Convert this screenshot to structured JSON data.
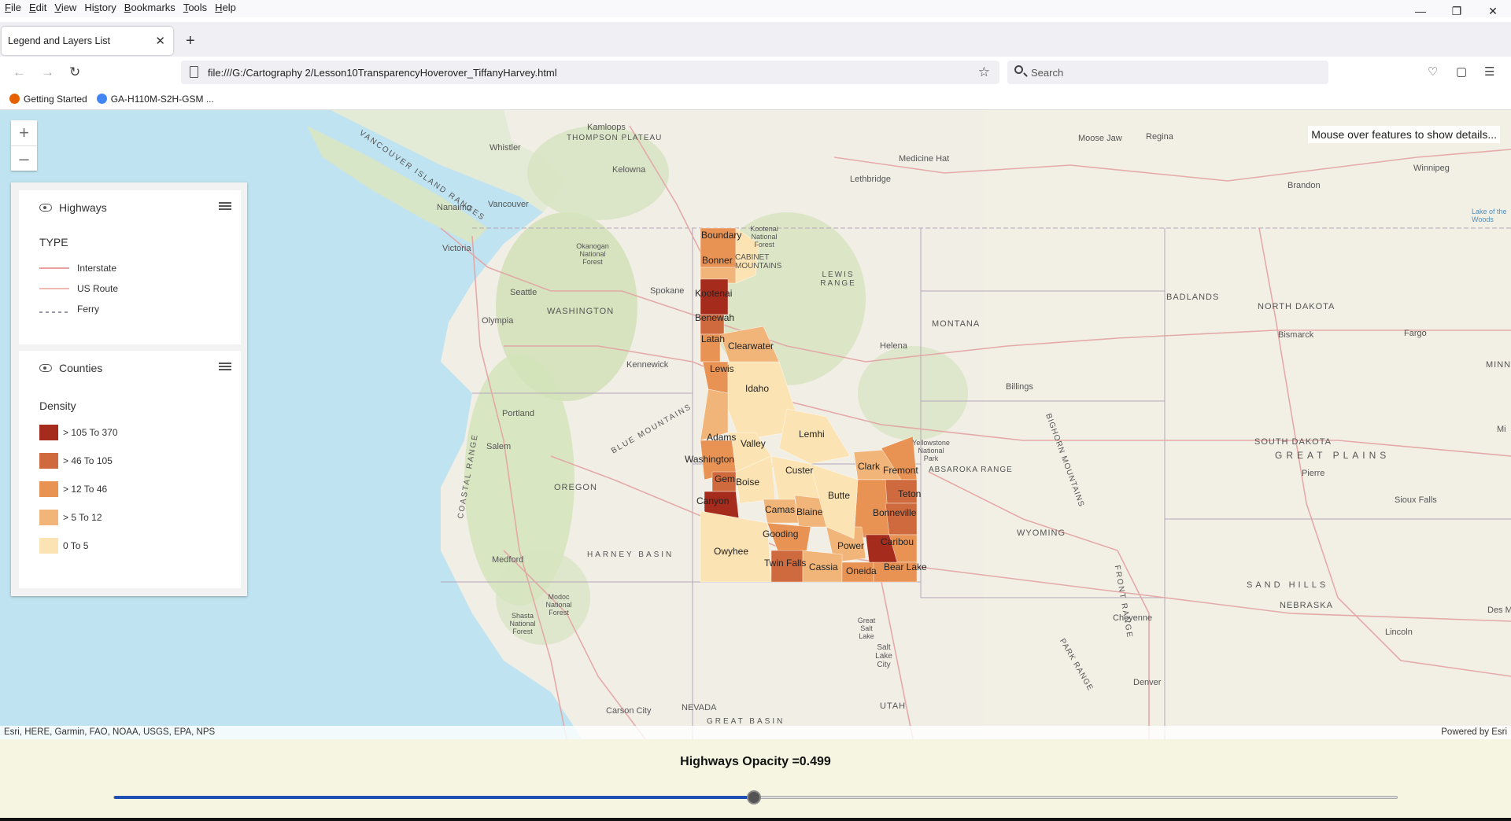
{
  "browser": {
    "menu": [
      {
        "pre": "",
        "u": "F",
        "post": "ile"
      },
      {
        "pre": "",
        "u": "E",
        "post": "dit"
      },
      {
        "pre": "",
        "u": "V",
        "post": "iew"
      },
      {
        "pre": "Hi",
        "u": "s",
        "post": "tory"
      },
      {
        "pre": "",
        "u": "B",
        "post": "ookmarks"
      },
      {
        "pre": "",
        "u": "T",
        "post": "ools"
      },
      {
        "pre": "",
        "u": "H",
        "post": "elp"
      }
    ],
    "tab_title": "Legend and Layers List",
    "url": "file:///G:/Cartography 2/Lesson10TransparencyHoverover_TiffanyHarvey.html",
    "search_placeholder": "Search",
    "bookmarks": [
      {
        "label": "Getting Started",
        "color": "#e66000"
      },
      {
        "label": "GA-H110M-S2H-GSM ...",
        "color": "#4285f4"
      }
    ]
  },
  "map": {
    "hover_text": "Mouse over features to show details...",
    "attribution": "Esri, HERE, Garmin, FAO, NOAA, USGS, EPA, NPS",
    "powered_by": "Powered by Esri",
    "place_labels": [
      "Kamloops",
      "THOMPSON PLATEAU",
      "Whistler",
      "Kelowna",
      "VANCOUVER ISLAND RANGES",
      "Nanaimo",
      "Vancouver",
      "Victoria",
      "Seattle",
      "Olympia",
      "WASHINGTON",
      "Okanogan National Forest",
      "Spokane",
      "Kennewick",
      "Portland",
      "Salem",
      "OREGON",
      "BLUE MOUNTAINS",
      "COASTAL RANGE",
      "HARNEY BASIN",
      "Medford",
      "Shasta National Forest",
      "Modoc National Forest",
      "Carson City",
      "NEVADA",
      "GREAT BASIN",
      "Lethbridge",
      "Medicine Hat",
      "Moose Jaw",
      "Regina",
      "Brandon",
      "Winnipeg",
      "Kootenai National Forest",
      "CABINET MOUNTAINS",
      "LEWIS RANGE",
      "MONTANA",
      "Helena",
      "Billings",
      "BADLANDS",
      "NORTH DAKOTA",
      "Bismarck",
      "Fargo",
      "SOUTH DAKOTA",
      "GREAT PLAINS",
      "Pierre",
      "Sioux Falls",
      "Yellowstone National Park",
      "ABSAROKA RANGE",
      "WYOMING",
      "BIGHORN MOUNTAINS",
      "SAND HILLS",
      "NEBRASKA",
      "Lincoln",
      "Cheyenne",
      "Denver",
      "Great Salt Lake",
      "Salt Lake City",
      "UTAH",
      "FRONT RANGE",
      "PARK RANGE",
      "Des M",
      "Lake of the Woods",
      "Mi",
      "MINN"
    ],
    "counties": [
      "Boundary",
      "Bonner",
      "Kootenai",
      "Benewah",
      "Latah",
      "Clearwater",
      "Lewis",
      "Idaho",
      "Adams",
      "Valley",
      "Lemhi",
      "Washington",
      "Gem",
      "Boise",
      "Custer",
      "Clark",
      "Fremont",
      "Canyon",
      "Butte",
      "Teton",
      "Camas",
      "Blaine",
      "Bonneville",
      "Gooding",
      "Power",
      "Caribou",
      "Owyhee",
      "Twin Falls",
      "Cassia",
      "Oneida",
      "Bear Lake"
    ]
  },
  "layer_list": {
    "highways": {
      "title": "Highways",
      "legend_title": "TYPE",
      "items": [
        {
          "label": "Interstate",
          "color": "#e8a0a0"
        },
        {
          "label": "US Route",
          "color": "#efb8b0"
        },
        {
          "label": "Ferry",
          "color": "#9a9aa8"
        }
      ]
    },
    "counties": {
      "title": "Counties",
      "legend_title": "Density",
      "items": [
        {
          "label": "> 105 To 370",
          "color": "#a52c1c"
        },
        {
          "label": "> 46 To 105",
          "color": "#cf6a3e"
        },
        {
          "label": "> 12 To 46",
          "color": "#e89354"
        },
        {
          "label": "> 5 To 12",
          "color": "#f1b57a"
        },
        {
          "label": "0 To 5",
          "color": "#fbe3b4"
        }
      ]
    }
  },
  "slider": {
    "title": "Highways Opacity =0.499",
    "value": 0.499
  }
}
